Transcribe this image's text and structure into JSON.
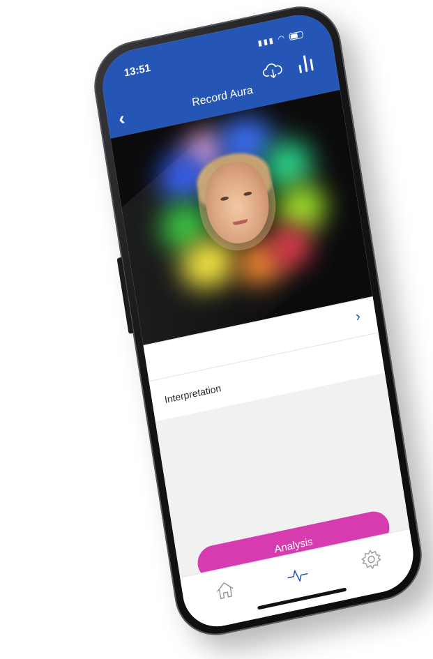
{
  "status_bar": {
    "time": "13:51"
  },
  "header": {
    "title": "Record Aura",
    "back_icon": "chevron-left-icon",
    "cloud_icon": "cloud-download-icon",
    "bars_icon": "bar-chart-icon"
  },
  "interpretation": {
    "label": "Interpretation"
  },
  "detail_row": {
    "chevron_icon": "chevron-right-icon"
  },
  "actions": {
    "analysis_label": "Analysis"
  },
  "tab_bar": {
    "items": [
      {
        "icon": "home-icon"
      },
      {
        "icon": "pulse-icon"
      },
      {
        "icon": "gear-icon"
      }
    ]
  },
  "colors": {
    "header": "#2556b6",
    "accent": "#d63caf",
    "screen_background": "#f1f1f2"
  }
}
